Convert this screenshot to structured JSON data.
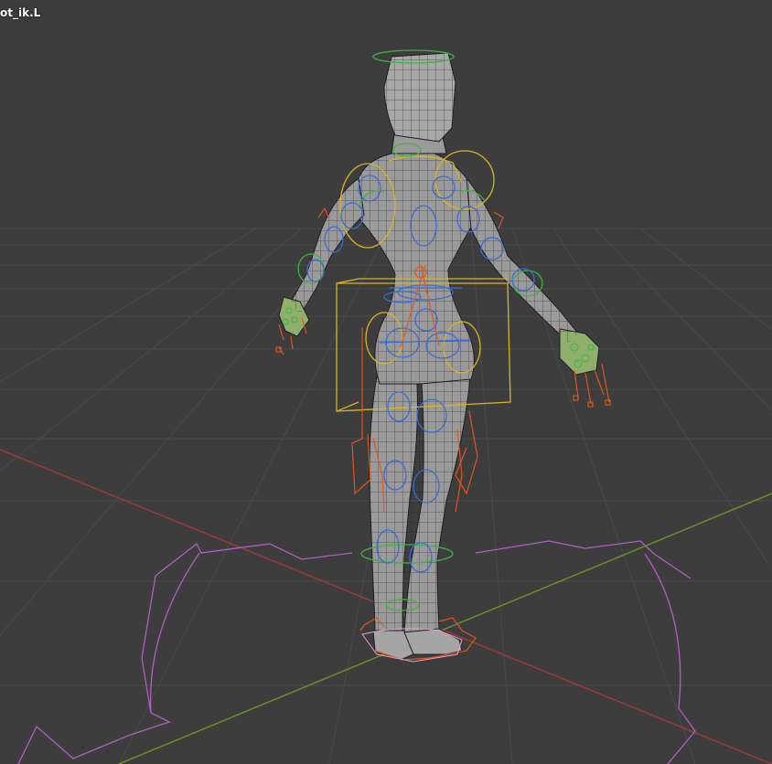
{
  "viewport": {
    "active_object_label": "ot_ik.L",
    "colors": {
      "background": "#3d3d3d",
      "grid": "#484848",
      "x_axis": "#9b3a3a",
      "y_axis": "#6b8f2c",
      "mesh_fill": "#9a9a9a",
      "mesh_wire": "#1e1e1e",
      "fk_control": "#3a6bd6",
      "ik_control": "#e0561f",
      "root_control": "#b060c0",
      "torso_control": "#d8b522",
      "tweak_control": "#3fb33f"
    }
  }
}
